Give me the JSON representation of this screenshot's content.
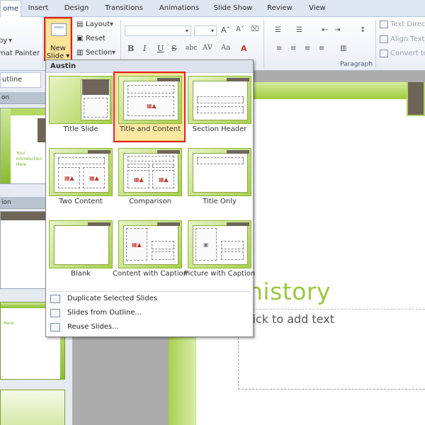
{
  "tabs": [
    "ome",
    "Insert",
    "Design",
    "Transitions",
    "Animations",
    "Slide Show",
    "Review",
    "View"
  ],
  "ribbon": {
    "clipboard": {
      "copy": "py",
      "format_painter": "mat Painter"
    },
    "slides": {
      "new_slide_line1": "New",
      "new_slide_line2": "Slide",
      "layout": "Layout",
      "reset": "Reset",
      "section": "Section"
    },
    "font": {
      "bold": "B",
      "italic": "I",
      "underline": "U",
      "strike": "S",
      "shadow": "abc",
      "spacing": "AV",
      "case": "Aa"
    },
    "paragraph": {
      "label": "Paragraph",
      "text_direction": "Text Directi",
      "align_text": "Align Text",
      "convert": "Convert to"
    }
  },
  "left_pane": {
    "outline_tab": "utline",
    "section_head_1": "on",
    "section_head_2": "ion",
    "thumb1_text": [
      "Your",
      "Introduction",
      "Here"
    ],
    "thumb3_text": "Here"
  },
  "gallery": {
    "header": "Austin",
    "layouts": [
      {
        "name": "Title Slide"
      },
      {
        "name": "Title and Content"
      },
      {
        "name": "Section Header"
      },
      {
        "name": "Two Content"
      },
      {
        "name": "Comparison"
      },
      {
        "name": "Title Only"
      },
      {
        "name": "Blank"
      },
      {
        "name": "Content with Caption"
      },
      {
        "name": "Picture with Caption"
      }
    ],
    "selected": "Title and Content",
    "menu": [
      {
        "label": "Duplicate Selected Slides"
      },
      {
        "label": "Slides from Outline..."
      },
      {
        "label": "Reuse Slides..."
      }
    ]
  },
  "slide": {
    "title_fragment": "nistory",
    "body_placeholder": "lick to add text"
  },
  "colors": {
    "accent_green": "#9bc73f",
    "dark_band": "#6e6558",
    "highlight_red": "#e02020",
    "selection_fill": "#fde8a3"
  }
}
